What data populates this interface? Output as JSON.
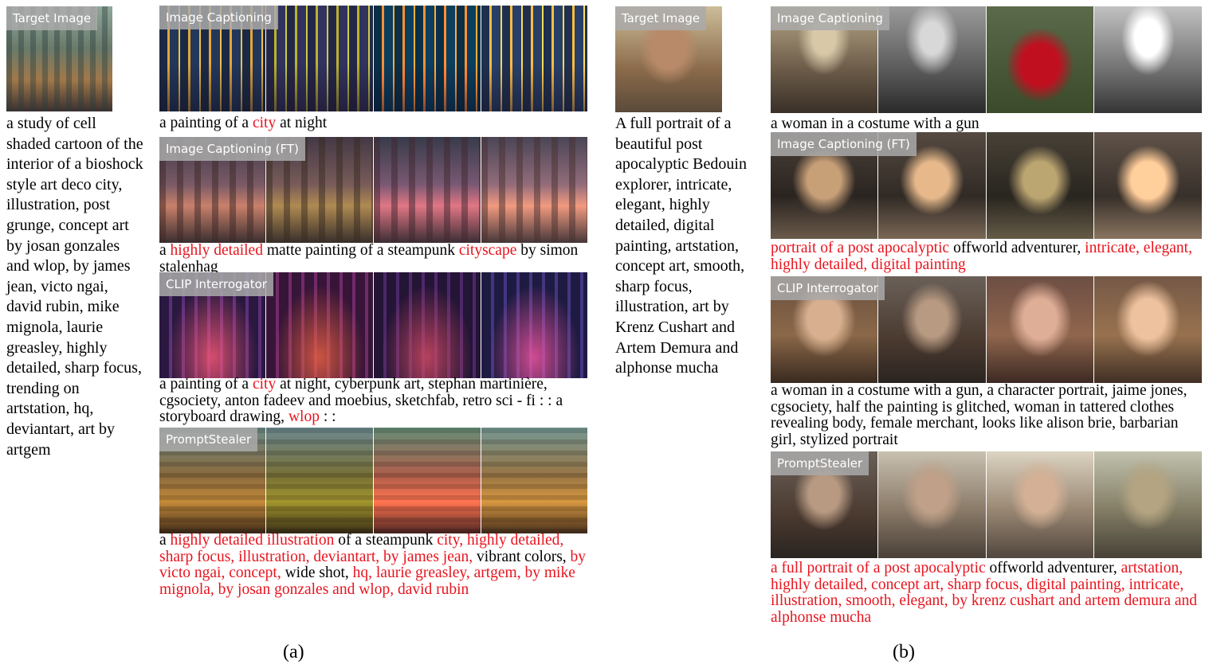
{
  "panel_a": {
    "target": {
      "tag": "Target Image",
      "prompt": "a study of cell shaded cartoon of the interior of a bioshock style art deco city, illustration, post grunge, concept art by josan gonzales and wlop, by james jean, victo ngai, david rubin, mike mignola, laurie greasley, highly detailed, sharp focus, trending on artstation, hq, deviantart, art by artgem"
    },
    "rows": [
      {
        "tag": "Image Captioning",
        "caption": [
          {
            "t": "a painting of a ",
            "red": false
          },
          {
            "t": "city",
            "red": true
          },
          {
            "t": " at night",
            "red": false
          }
        ]
      },
      {
        "tag": "Image Captioning (FT)",
        "caption": [
          {
            "t": "a ",
            "red": false
          },
          {
            "t": "highly detailed",
            "red": true
          },
          {
            "t": " matte painting of a steampunk ",
            "red": false
          },
          {
            "t": "cityscape",
            "red": true
          },
          {
            "t": " by simon stalenhag",
            "red": false
          }
        ]
      },
      {
        "tag": "CLIP Interrogator",
        "caption": [
          {
            "t": "a painting of a ",
            "red": false
          },
          {
            "t": "city",
            "red": true
          },
          {
            "t": " at night, cyberpunk art, stephan martinière, cgsociety, anton fadeev and moebius, sketchfab, retro sci - fi : : a storyboard drawing, ",
            "red": false
          },
          {
            "t": "wlop",
            "red": true
          },
          {
            "t": " : :",
            "red": false
          }
        ]
      },
      {
        "tag": "PromptStealer",
        "caption": [
          {
            "t": "a ",
            "red": false
          },
          {
            "t": "highly detailed illustration",
            "red": true
          },
          {
            "t": " of a steampunk ",
            "red": false
          },
          {
            "t": "city, highly detailed, sharp focus, illustration, deviantart, by james jean,",
            "red": true
          },
          {
            "t": " vibrant colors, ",
            "red": false
          },
          {
            "t": "by victo ngai, concept,",
            "red": true
          },
          {
            "t": " wide shot, ",
            "red": false
          },
          {
            "t": "hq, laurie greasley, artgem, by mike mignola, by josan gonzales and wlop, david rubin",
            "red": true
          }
        ]
      }
    ],
    "label": "(a)"
  },
  "panel_b": {
    "target": {
      "tag": "Target Image",
      "prompt": "A full portrait of a beautiful post apocalyptic Bedouin explorer, intricate, elegant, highly detailed, digital painting, artstation, concept art, smooth, sharp focus, illustration, art by Krenz Cushart and Artem Demura and alphonse mucha"
    },
    "rows": [
      {
        "tag": "Image Captioning",
        "caption": [
          {
            "t": "a woman in a costume with a gun",
            "red": false
          }
        ]
      },
      {
        "tag": "Image Captioning (FT)",
        "caption": [
          {
            "t": "portrait of a post apocalyptic",
            "red": true
          },
          {
            "t": " offworld adventurer, ",
            "red": false
          },
          {
            "t": "intricate, elegant, highly detailed, digital painting",
            "red": true
          }
        ]
      },
      {
        "tag": "CLIP Interrogator",
        "caption": [
          {
            "t": "a woman in a costume with a gun, a character portrait, jaime jones, cgsociety, half the painting is glitched, woman in tattered clothes revealing body, female merchant, looks like alison brie, barbarian girl, stylized portrait",
            "red": false
          }
        ]
      },
      {
        "tag": "PromptStealer",
        "caption": [
          {
            "t": "a full portrait of a post apocalyptic",
            "red": true
          },
          {
            "t": " offworld adventurer, ",
            "red": false
          },
          {
            "t": "artstation, highly detailed, concept art, sharp focus, digital painting, intricate, illustration, smooth, elegant, by krenz cushart and artem demura and alphonse mucha",
            "red": true
          }
        ]
      }
    ],
    "label": "(b)"
  }
}
